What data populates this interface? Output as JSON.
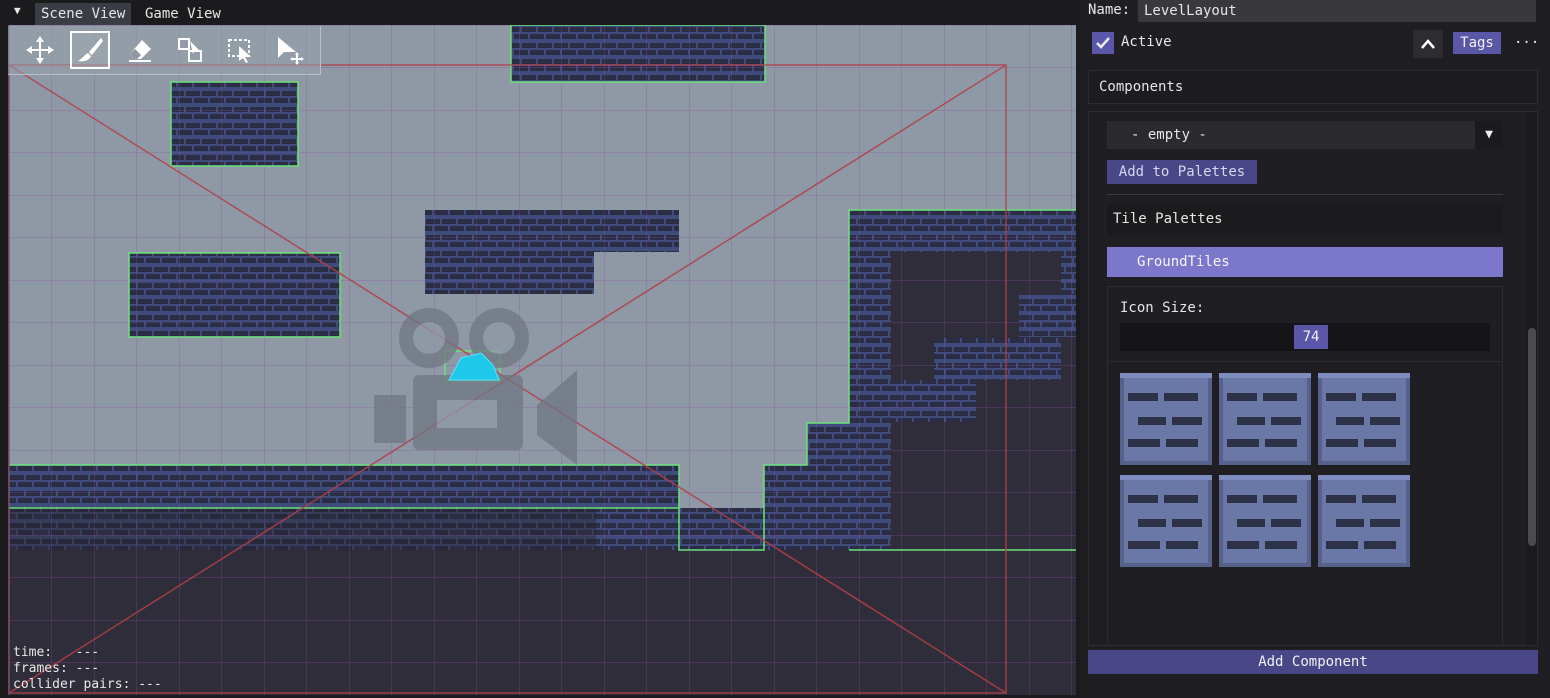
{
  "tabs": [
    {
      "label": "Scene View",
      "active": true
    },
    {
      "label": "Game View",
      "active": false
    }
  ],
  "toolbar": {
    "tools": [
      {
        "name": "move-tool-icon",
        "active": false
      },
      {
        "name": "brush-tool-icon",
        "active": true
      },
      {
        "name": "eraser-tool-icon",
        "active": false
      },
      {
        "name": "tile-select-tool-icon",
        "active": false
      },
      {
        "name": "box-select-tool-icon",
        "active": false
      },
      {
        "name": "pointer-move-tool-icon",
        "active": false
      }
    ]
  },
  "stats": {
    "time": "time:   ---",
    "frames": "frames: ---",
    "collider_pairs": "collider pairs: ---"
  },
  "inspector": {
    "name_label": "Name:",
    "name_value": "LevelLayout",
    "active_label": "Active",
    "active_checked": true,
    "tags_label": "Tags",
    "more_label": "···",
    "components_label": "Components",
    "palette_select_value": "- empty -",
    "add_to_palettes_label": "Add to Palettes",
    "tile_palettes_label": "Tile Palettes",
    "palette_items": [
      "GroundTiles"
    ],
    "icon_size_label": "Icon Size:",
    "icon_size_value": "74",
    "add_component_label": "Add Component"
  },
  "colors": {
    "accent": "#5a57a8",
    "accent_selected": "#7b78cc",
    "scene_background": "#8e99a5",
    "collider_outline": "#6ee27a",
    "camera_frustum": "#b0404a",
    "brick_tile": "#3f4b7a"
  }
}
